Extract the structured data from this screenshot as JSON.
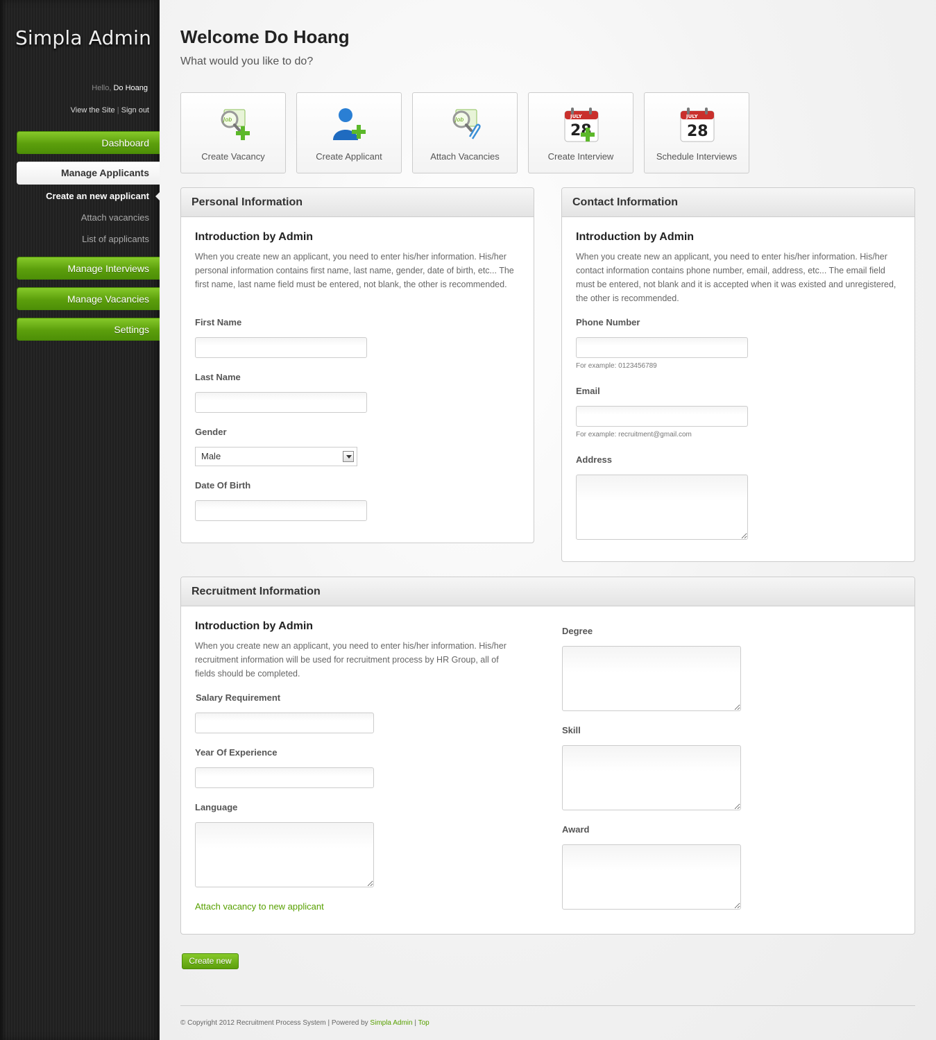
{
  "sidebar": {
    "logo": "Simpla Admin",
    "hello": "Hello,",
    "user_name": "Do Hoang",
    "view_site": "View the Site",
    "separator": "|",
    "sign_out": "Sign out",
    "nav": {
      "dashboard": "Dashboard",
      "manage_applicants": "Manage Applicants",
      "sub_create": "Create an new applicant",
      "sub_attach": "Attach vacancies",
      "sub_list": "List of applicants",
      "manage_interviews": "Manage Interviews",
      "manage_vacancies": "Manage Vacancies",
      "settings": "Settings"
    }
  },
  "header": {
    "welcome": "Welcome Do Hoang",
    "subtitle": "What would you like to do?"
  },
  "shortcuts": [
    {
      "label": "Create Vacancy",
      "icon": "job-search-add-icon"
    },
    {
      "label": "Create Applicant",
      "icon": "user-add-icon"
    },
    {
      "label": "Attach Vacancies",
      "icon": "job-attach-icon"
    },
    {
      "label": "Create Interview",
      "icon": "calendar-add-icon",
      "month": "JULY",
      "day": "28"
    },
    {
      "label": "Schedule Interviews",
      "icon": "calendar-icon",
      "month": "JULY",
      "day": "28"
    }
  ],
  "personal": {
    "title": "Personal Information",
    "intro_title": "Introduction by Admin",
    "intro_text": "When you create new an applicant, you need to enter his/her information. His/her personal information contains first name, last name, gender, date of birth, etc... The first name, last name field must be entered, not blank, the other is recommended.",
    "first_name_label": "First Name",
    "last_name_label": "Last Name",
    "gender_label": "Gender",
    "gender_value": "Male",
    "dob_label": "Date Of Birth"
  },
  "contact": {
    "title": "Contact Information",
    "intro_title": "Introduction by Admin",
    "intro_text": "When you create new an applicant, you need to enter his/her information. His/her contact information contains phone number, email, address, etc... The email field must be entered, not blank and it is accepted when it was existed and unregistered, the other is recommended.",
    "phone_label": "Phone Number",
    "phone_hint": "For example: 0123456789",
    "email_label": "Email",
    "email_hint": "For example: recruitment@gmail.com",
    "address_label": "Address"
  },
  "recruitment": {
    "title": "Recruitment Information",
    "intro_title": "Introduction by Admin",
    "intro_text": "When you create new an applicant, you need to enter his/her information. His/her recruitment information will be used for recruitment process by HR Group, all of fields should be completed.",
    "salary_label": "Salary Requirement",
    "experience_label": "Year Of Experience",
    "language_label": "Language",
    "attach_link": "Attach vacancy to new applicant",
    "degree_label": "Degree",
    "skill_label": "Skill",
    "award_label": "Award"
  },
  "actions": {
    "create_new": "Create new"
  },
  "footer": {
    "copyright": "© Copyright 2012 Recruitment Process System | Powered by",
    "powered_link": "Simpla Admin",
    "sep": "|",
    "top_link": "Top"
  },
  "colors": {
    "accent_green": "#5c9f0c",
    "link_green": "#57a000",
    "sidebar_bg": "#222222"
  }
}
